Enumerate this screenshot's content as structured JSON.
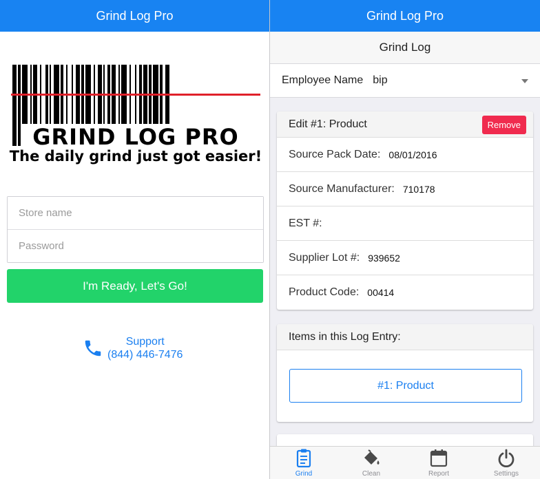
{
  "login": {
    "app_title": "Grind Log Pro",
    "logo": {
      "title": "GRIND LOG PRO",
      "tagline": "The daily grind just got easier!"
    },
    "store_name": {
      "placeholder": "Store name",
      "value": ""
    },
    "password": {
      "placeholder": "Password",
      "value": ""
    },
    "go_label": "I'm Ready, Let's Go!",
    "support": {
      "label": "Support",
      "phone": "(844) 446-7476",
      "icon": "phone-icon"
    }
  },
  "log": {
    "app_title": "Grind Log Pro",
    "section_title": "Grind Log",
    "employee": {
      "label": "Employee Name",
      "value": "bip"
    },
    "edit_card": {
      "title": "Edit #1: Product",
      "remove_label": "Remove",
      "fields": [
        {
          "label": "Source Pack Date:",
          "value": "08/01/2016"
        },
        {
          "label": "Source Manufacturer:",
          "value": "710178"
        },
        {
          "label": "EST #:",
          "value": ""
        },
        {
          "label": "Supplier Lot #:",
          "value": "939652"
        },
        {
          "label": "Product Code:",
          "value": "00414"
        }
      ]
    },
    "items_card": {
      "title": "Items in this Log Entry:",
      "items": [
        "#1: Product"
      ]
    },
    "tabs": [
      {
        "label": "Grind",
        "icon": "clipboard-icon",
        "active": true
      },
      {
        "label": "Clean",
        "icon": "paint-bucket-icon",
        "active": false
      },
      {
        "label": "Report",
        "icon": "calendar-icon",
        "active": false
      },
      {
        "label": "Settings",
        "icon": "power-icon",
        "active": false
      }
    ]
  },
  "colors": {
    "appbar": "#1883f2",
    "go_button": "#22d36a",
    "remove_button": "#f02b4e",
    "link_blue": "#1a7ff0",
    "logo_scanline": "#e0202a"
  }
}
